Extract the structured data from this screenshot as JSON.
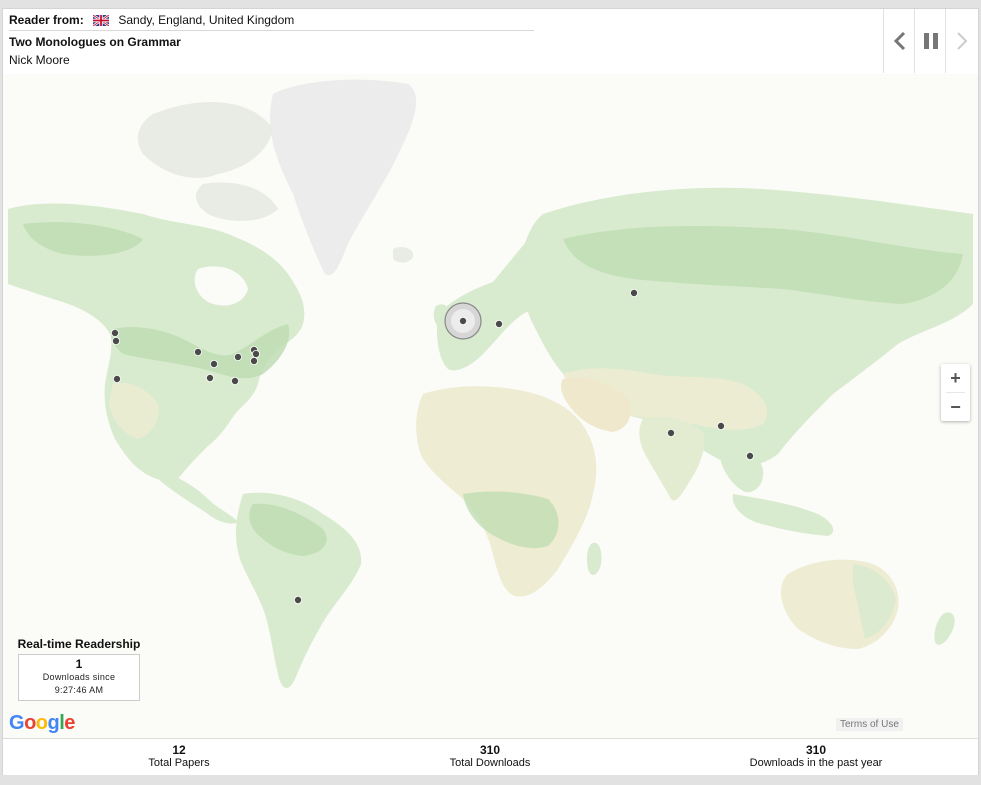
{
  "header": {
    "reader_label": "Reader from:",
    "reader_location": "Sandy, England, United Kingdom",
    "paper_title": "Two Monologues on Grammar",
    "author": "Nick Moore"
  },
  "map": {
    "google_logo": "Google",
    "terms_label": "Terms of Use",
    "zoom_in_label": "+",
    "zoom_out_label": "−",
    "reader_locations": [
      {
        "place": "Pacific Northwest, US",
        "active": false
      },
      {
        "place": "Oregon, US",
        "active": false
      },
      {
        "place": "California, US",
        "active": false
      },
      {
        "place": "Midwest, US",
        "active": false
      },
      {
        "place": "Illinois, US",
        "active": false
      },
      {
        "place": "Missouri, US",
        "active": false
      },
      {
        "place": "Ohio, US",
        "active": false
      },
      {
        "place": "Kentucky / Tennessee, US",
        "active": false
      },
      {
        "place": "New York, US",
        "active": false
      },
      {
        "place": "Pennsylvania, US",
        "active": false
      },
      {
        "place": "Virginia, US",
        "active": false
      },
      {
        "place": "Sandy, England, United Kingdom",
        "active": true
      },
      {
        "place": "Poland",
        "active": false
      },
      {
        "place": "Russia",
        "active": false
      },
      {
        "place": "India (Mumbai)",
        "active": false
      },
      {
        "place": "Bangladesh",
        "active": false
      },
      {
        "place": "Thailand / Malaysia",
        "active": false
      },
      {
        "place": "Argentina",
        "active": false
      }
    ]
  },
  "realtime": {
    "title": "Real-time Readership",
    "count": "1",
    "downloads_since_label": "Downloads since",
    "since_time": "9:27:46 AM"
  },
  "footer": {
    "stats": [
      {
        "value": "12",
        "label": "Total Papers"
      },
      {
        "value": "310",
        "label": "Total Downloads"
      },
      {
        "value": "310",
        "label": "Downloads in the past year"
      }
    ]
  },
  "colors": {
    "land": "#d9ebcf",
    "land_forest": "#bcdcb0",
    "land_dry": "#eeecd2",
    "ice": "#eeeeee",
    "water": "#fbfbf7",
    "marker": "#4a4a4a"
  }
}
